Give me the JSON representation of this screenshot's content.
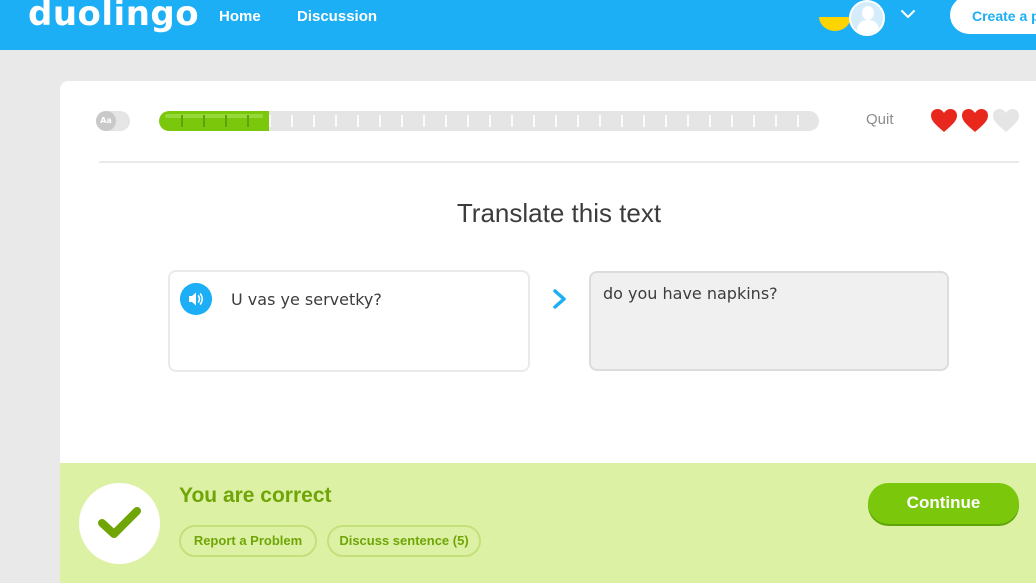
{
  "nav": {
    "logo": "duolingo",
    "home": "Home",
    "discussion": "Discussion",
    "create_button": "Create a profile",
    "course_flag_icon": "ukraine-flag-icon",
    "avatar_icon": "user-avatar-icon",
    "menu_icon": "chevron-down-icon"
  },
  "lesson": {
    "font_toggle_label": "Aa",
    "progress_fraction": 0.167,
    "progress_segments": 30,
    "quit": "Quit",
    "hearts": [
      {
        "state": "full",
        "icon": "heart-icon"
      },
      {
        "state": "full",
        "icon": "heart-icon"
      },
      {
        "state": "empty",
        "icon": "heart-icon"
      }
    ],
    "title": "Translate this text",
    "source_text": "U vas ye servetky?",
    "speaker_icon": "speaker-icon",
    "arrow_icon": "chevron-right-icon",
    "answer_text": "do you have napkins?"
  },
  "footer": {
    "status": "You are correct",
    "check_icon": "checkmark-icon",
    "report_button": "Report a Problem",
    "discuss_button": "Discuss sentence (5)",
    "continue_button": "Continue"
  },
  "colors": {
    "brand_blue": "#1caff6",
    "success_green": "#7ac70c",
    "success_bg": "#ddf1a5",
    "heart_red": "#e8281c",
    "heart_empty": "#e5e5e5"
  }
}
